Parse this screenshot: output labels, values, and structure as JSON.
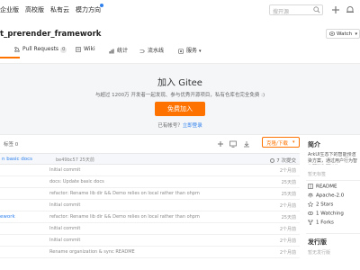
{
  "nav": {
    "items": [
      "企业版",
      "高校版",
      "私有云",
      "模力方向"
    ],
    "search_placeholder": "搜开源"
  },
  "repo": {
    "title": "t_prerender_framework",
    "watch_label": "Watch"
  },
  "tabs": [
    {
      "label": ""
    },
    {
      "label": "Pull Requests",
      "badge": "0"
    },
    {
      "label": "Wiki"
    },
    {
      "label": "统计"
    },
    {
      "label": "流水线"
    },
    {
      "label": "服务"
    }
  ],
  "banner": {
    "title": "加入 Gitee",
    "desc": "与超过 1200万 开发者一起发现、参与优秀开源项目，私有仓库也完全免费 :)",
    "join_label": "免费加入",
    "login_prefix": "已有帐号？",
    "login_link": "立即登录"
  },
  "toolbar": {
    "tags": "标签 0",
    "clone_label": "克隆/下载"
  },
  "latest_commit": {
    "message": "n basic docs",
    "hash": "be49bc57",
    "time": "25天前",
    "count": "7 次提交"
  },
  "files": [
    {
      "name": "",
      "message": "Initial commit",
      "time": "2个月前"
    },
    {
      "name": "",
      "message": "docs: Update basic docs",
      "time": "25天前"
    },
    {
      "name": "",
      "message": "refactor: Rename lib dir && Demo relies on local rather than ohpm",
      "time": "25天前"
    },
    {
      "name": "",
      "message": "Initial commit",
      "time": "2个月前"
    },
    {
      "name": "ework",
      "message": "refactor: Rename lib dir && Demo relies on local rather than ohpm",
      "time": "25天前"
    },
    {
      "name": "",
      "message": "Initial commit",
      "time": "2个月前"
    },
    {
      "name": "",
      "message": "Initial commit",
      "time": "2个月前"
    },
    {
      "name": "",
      "message": "Rename organization & sync README",
      "time": "2个月前"
    }
  ],
  "sidebar": {
    "intro_title": "简介",
    "intro_text": "ArkUI生态下的智能预渲染方案，通过用户行为智能预测和预渲染...",
    "no_tags": "暂无标签",
    "readme": "README",
    "license": "Apache-2.0",
    "stars": "2 Stars",
    "watching": "1 Watching",
    "forks": "1 Forks",
    "release_title": "发行版",
    "no_release": "暂无发行版"
  },
  "colors": {
    "accent": "#fe7300",
    "link": "#2f80ed"
  }
}
